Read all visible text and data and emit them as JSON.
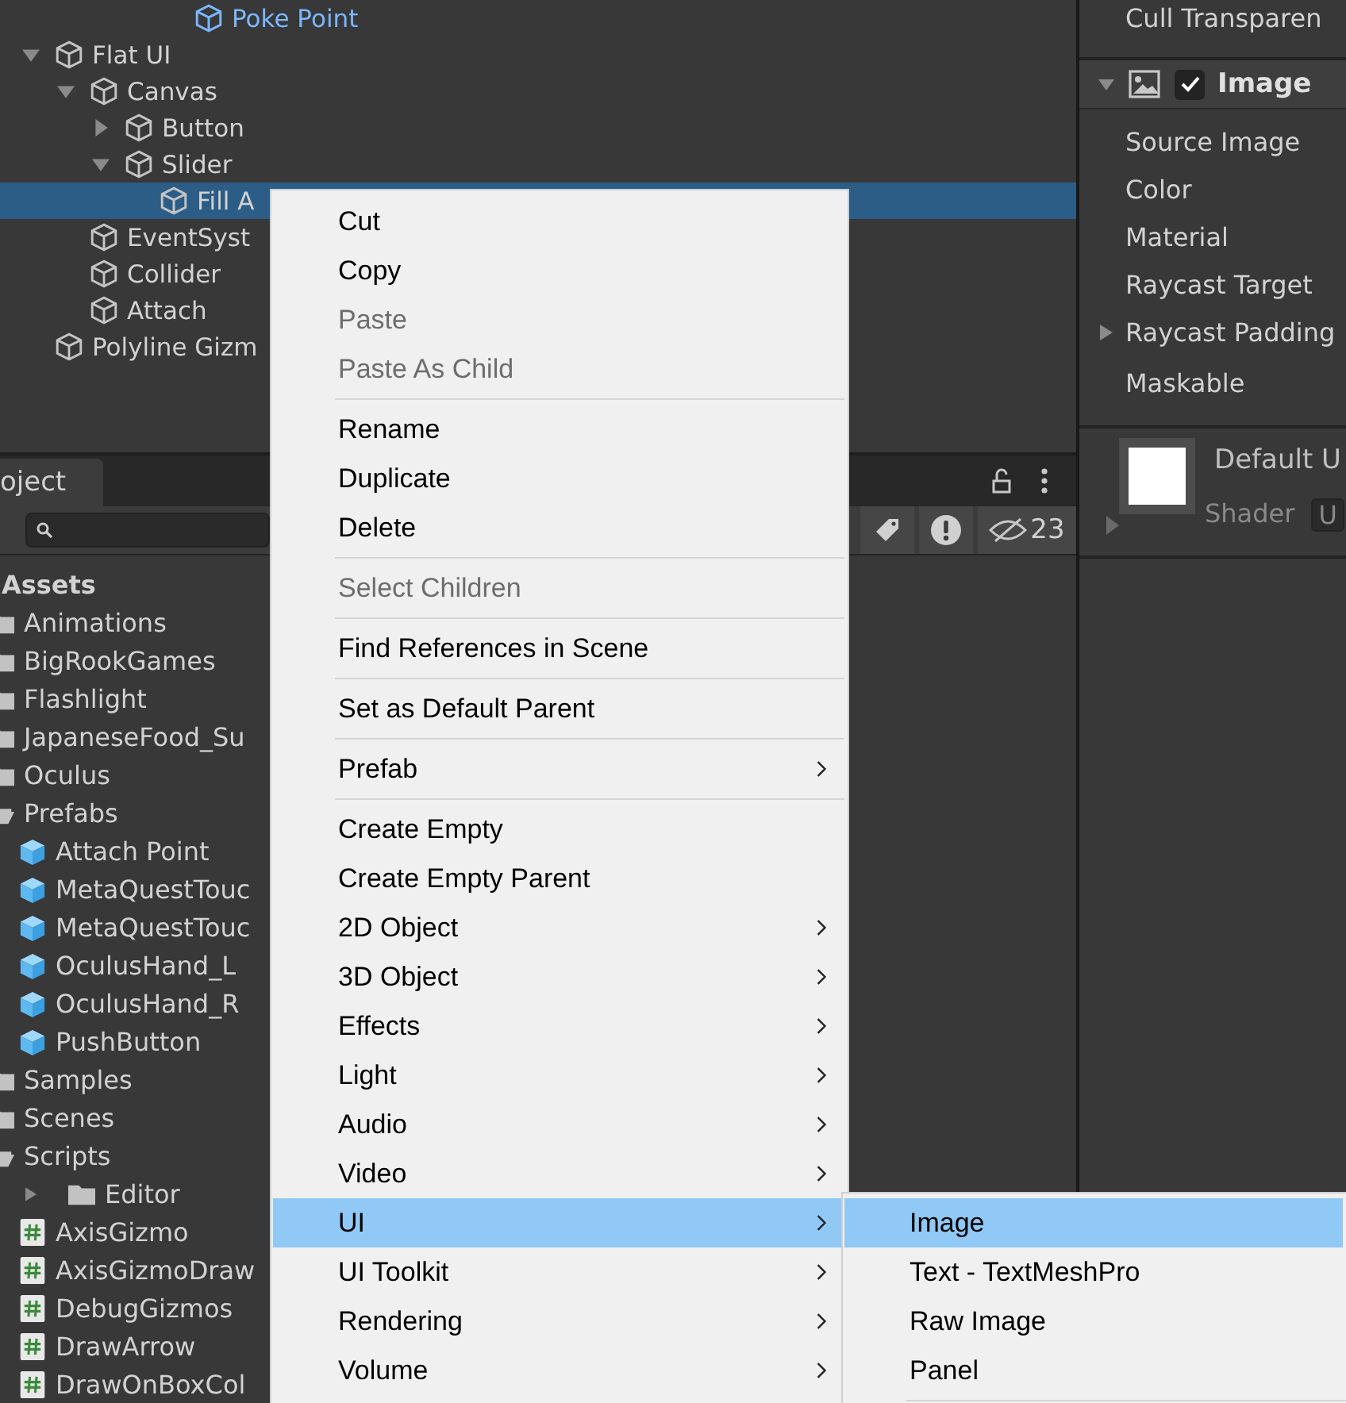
{
  "hierarchy": {
    "cut_top_item": {
      "name": "Poke Point",
      "kind": "prefab"
    },
    "tree": [
      {
        "name": "Flat UI",
        "expanded": true,
        "selected": false,
        "children": [
          {
            "name": "Canvas",
            "expanded": true,
            "selected": false,
            "children": [
              {
                "name": "Button",
                "expanded": false,
                "selected": false
              },
              {
                "name": "Slider",
                "expanded": true,
                "selected": false,
                "children": [
                  {
                    "name": "Fill A",
                    "selected": true
                  }
                ]
              }
            ]
          },
          {
            "name": "EventSyst",
            "selected": false
          },
          {
            "name": "Collider",
            "selected": false
          },
          {
            "name": "Attach",
            "selected": false
          }
        ]
      },
      {
        "name": "Polyline Gizm",
        "selected": false
      }
    ]
  },
  "project": {
    "tab": "oject",
    "hidden_count": "23",
    "root": "Assets",
    "items": [
      {
        "name": "Animations",
        "kind": "folder"
      },
      {
        "name": "BigRookGames",
        "kind": "folder"
      },
      {
        "name": "Flashlight",
        "kind": "folder"
      },
      {
        "name": "JapaneseFood_Su",
        "kind": "folder"
      },
      {
        "name": "Oculus",
        "kind": "folder"
      },
      {
        "name": "Prefabs",
        "kind": "folder",
        "expanded": true,
        "children": [
          {
            "name": "Attach Point",
            "kind": "prefab"
          },
          {
            "name": "MetaQuestTouc",
            "kind": "prefab"
          },
          {
            "name": "MetaQuestTouc",
            "kind": "prefab"
          },
          {
            "name": "OculusHand_L",
            "kind": "prefab"
          },
          {
            "name": "OculusHand_R",
            "kind": "prefab"
          },
          {
            "name": "PushButton",
            "kind": "prefab"
          }
        ]
      },
      {
        "name": "Samples",
        "kind": "folder"
      },
      {
        "name": "Scenes",
        "kind": "folder"
      },
      {
        "name": "Scripts",
        "kind": "folder",
        "expanded": true,
        "children": [
          {
            "name": "Editor",
            "kind": "folder",
            "expanded": false
          },
          {
            "name": "AxisGizmo",
            "kind": "script"
          },
          {
            "name": "AxisGizmoDraw",
            "kind": "script"
          },
          {
            "name": "DebugGizmos",
            "kind": "script"
          },
          {
            "name": "DrawArrow",
            "kind": "script"
          },
          {
            "name": "DrawOnBoxCol",
            "kind": "script"
          }
        ]
      }
    ]
  },
  "inspector": {
    "cut_row": "Cull Transparen",
    "component": {
      "title": "Image",
      "enabled": true,
      "expanded": true,
      "fields": [
        {
          "label": "Source Image"
        },
        {
          "label": "Color"
        },
        {
          "label": "Material"
        },
        {
          "label": "Raycast Target"
        },
        {
          "label": "Raycast Padding",
          "expanded": false
        },
        {
          "label": "Maskable"
        }
      ]
    },
    "material": {
      "name": "Default U",
      "shader_label": "Shader",
      "shader_value": "U"
    }
  },
  "context_menu": {
    "items": [
      {
        "kind": "item",
        "label": "Cut",
        "disabled": false
      },
      {
        "kind": "item",
        "label": "Copy",
        "disabled": false
      },
      {
        "kind": "item",
        "label": "Paste",
        "disabled": true
      },
      {
        "kind": "item",
        "label": "Paste As Child",
        "disabled": true
      },
      {
        "kind": "separator"
      },
      {
        "kind": "item",
        "label": "Rename",
        "disabled": false
      },
      {
        "kind": "item",
        "label": "Duplicate",
        "disabled": false
      },
      {
        "kind": "item",
        "label": "Delete",
        "disabled": false
      },
      {
        "kind": "separator"
      },
      {
        "kind": "item",
        "label": "Select Children",
        "disabled": true
      },
      {
        "kind": "separator"
      },
      {
        "kind": "item",
        "label": "Find References in Scene",
        "disabled": false
      },
      {
        "kind": "separator"
      },
      {
        "kind": "item",
        "label": "Set as Default Parent",
        "disabled": false
      },
      {
        "kind": "separator"
      },
      {
        "kind": "item",
        "label": "Prefab",
        "disabled": false,
        "submenu": true,
        "selected": false
      },
      {
        "kind": "separator"
      },
      {
        "kind": "item",
        "label": "Create Empty",
        "disabled": false
      },
      {
        "kind": "item",
        "label": "Create Empty Parent",
        "disabled": false
      },
      {
        "kind": "item",
        "label": "2D Object",
        "disabled": false,
        "submenu": true,
        "selected": false
      },
      {
        "kind": "item",
        "label": "3D Object",
        "disabled": false,
        "submenu": true,
        "selected": false
      },
      {
        "kind": "item",
        "label": "Effects",
        "disabled": false,
        "submenu": true,
        "selected": false
      },
      {
        "kind": "item",
        "label": "Light",
        "disabled": false,
        "submenu": true,
        "selected": false
      },
      {
        "kind": "item",
        "label": "Audio",
        "disabled": false,
        "submenu": true,
        "selected": false
      },
      {
        "kind": "item",
        "label": "Video",
        "disabled": false,
        "submenu": true,
        "selected": false
      },
      {
        "kind": "item",
        "label": "UI",
        "disabled": false,
        "submenu": true,
        "selected": true
      },
      {
        "kind": "item",
        "label": "UI Toolkit",
        "disabled": false,
        "submenu": true,
        "selected": false
      },
      {
        "kind": "item",
        "label": "Rendering",
        "disabled": false,
        "submenu": true,
        "selected": false
      },
      {
        "kind": "item",
        "label": "Volume",
        "disabled": false,
        "submenu": true,
        "selected": false
      }
    ]
  },
  "submenu": {
    "items": [
      {
        "kind": "item",
        "label": "Image",
        "selected": true
      },
      {
        "kind": "item",
        "label": "Text - TextMeshPro",
        "selected": false
      },
      {
        "kind": "item",
        "label": "Raw Image",
        "selected": false
      },
      {
        "kind": "item",
        "label": "Panel",
        "selected": false
      },
      {
        "kind": "separator"
      }
    ]
  }
}
